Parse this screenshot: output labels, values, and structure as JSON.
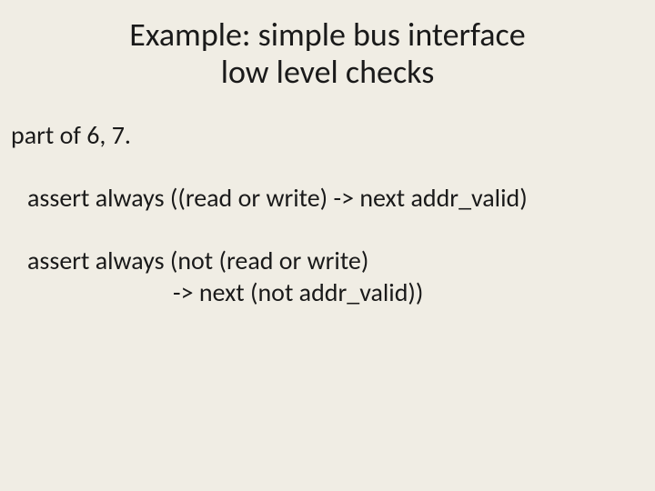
{
  "title_line1": "Example: simple bus interface",
  "title_line2": "low level checks",
  "subhead": "part of 6, 7.",
  "assert1": "assert always ((read or write) -> next addr_valid)",
  "assert2_line1": "assert always (not (read or write)",
  "assert2_line2": "-> next (not addr_valid))"
}
